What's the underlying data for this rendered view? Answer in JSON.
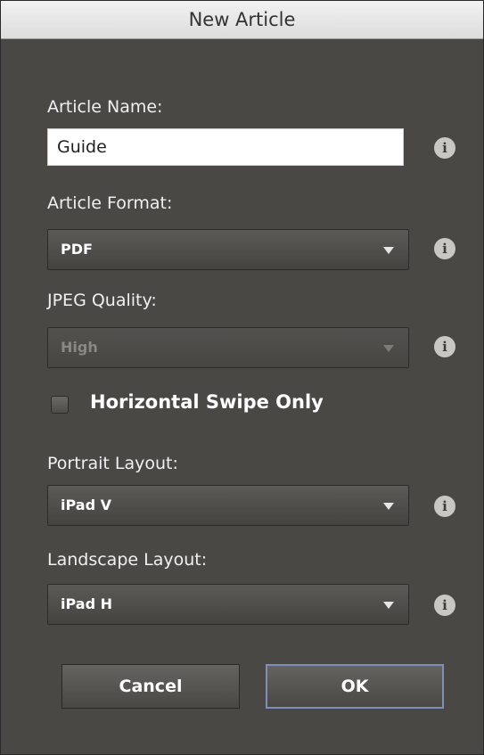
{
  "dialog": {
    "title": "New Article"
  },
  "fields": {
    "article_name": {
      "label": "Article Name:",
      "value": "Guide"
    },
    "article_format": {
      "label": "Article Format:",
      "value": "PDF"
    },
    "jpeg_quality": {
      "label": "JPEG Quality:",
      "value": "High",
      "disabled": true
    },
    "horizontal_swipe": {
      "label": "Horizontal Swipe Only",
      "checked": false
    },
    "portrait_layout": {
      "label": "Portrait Layout:",
      "value": "iPad V"
    },
    "landscape_layout": {
      "label": "Landscape Layout:",
      "value": "iPad H"
    }
  },
  "info_icon_glyph": "i",
  "buttons": {
    "cancel": "Cancel",
    "ok": "OK"
  },
  "colors": {
    "dialog_bg": "#4a4845",
    "ok_border": "#7e8fb9"
  }
}
